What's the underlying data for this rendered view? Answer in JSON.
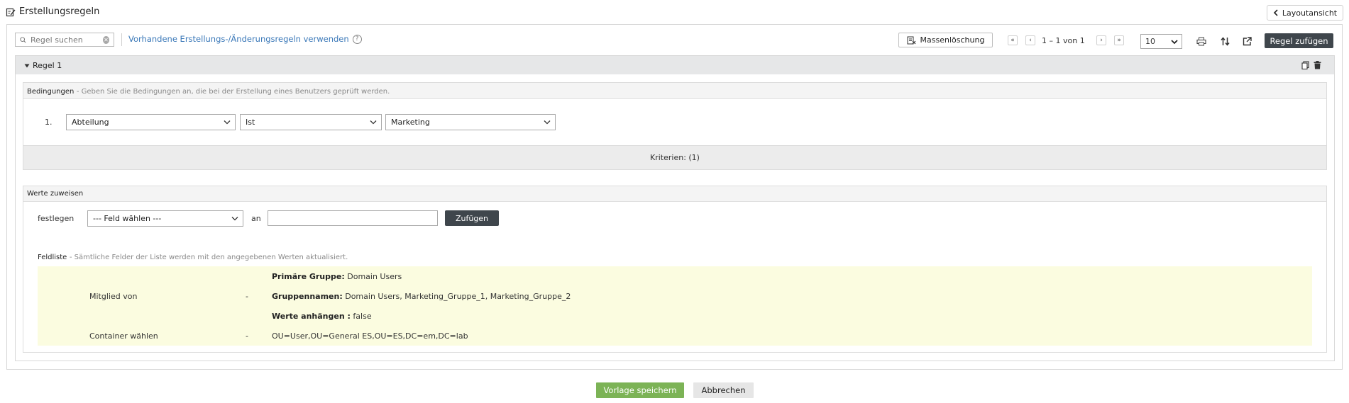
{
  "header": {
    "title": "Erstellungsregeln",
    "title_icon": "edit-icon",
    "layout_button": "Layoutansicht"
  },
  "toolbar": {
    "search_placeholder": "Regel suchen",
    "use_rules_link": "Vorhandene Erstellungs-/Änderungsregeln verwenden",
    "mass_delete": "Massenlöschung",
    "page_info": "1 – 1 von 1",
    "per_page": "10",
    "add_rule": "Regel zufügen"
  },
  "rule": {
    "title": "Regel 1",
    "conditions": {
      "title": "Bedingungen",
      "subtitle": "- Geben Sie die Bedingungen an, die bei der Erstellung eines Benutzers geprüft werden.",
      "rows": [
        {
          "num": "1.",
          "field": "Abteilung",
          "operator": "Ist",
          "value": "Marketing"
        }
      ],
      "criteria": "Kriterien: (1)"
    },
    "assign": {
      "title": "Werte zuweisen",
      "set_label": "festlegen",
      "field_select": "--- Feld wählen ---",
      "to_label": "an",
      "value": "",
      "add_button": "Zufügen",
      "field_list_title": "Feldliste",
      "field_list_subtitle": "- Sämtliche Felder der Liste werden mit den angegebenen Werten aktualisiert.",
      "member_of": {
        "label": "Mitglied von",
        "dash": "-",
        "primary_group_key": "Primäre Gruppe:",
        "primary_group_value": "Domain Users",
        "group_names_key": "Gruppennamen:",
        "group_names_value": "Domain Users, Marketing_Gruppe_1, Marketing_Gruppe_2",
        "append_key": "Werte anhängen :",
        "append_value": "false"
      },
      "container": {
        "label": "Container wählen",
        "dash": "-",
        "value": "OU=User,OU=General ES,OU=ES,DC=em,DC=lab"
      }
    }
  },
  "footer": {
    "save": "Vorlage speichern",
    "cancel": "Abbrechen"
  },
  "colors": {
    "dark_button": "#3f464c",
    "save_green": "#7cb356",
    "link_blue": "#3a78b8",
    "field_list_bg": "#fbfce0"
  }
}
